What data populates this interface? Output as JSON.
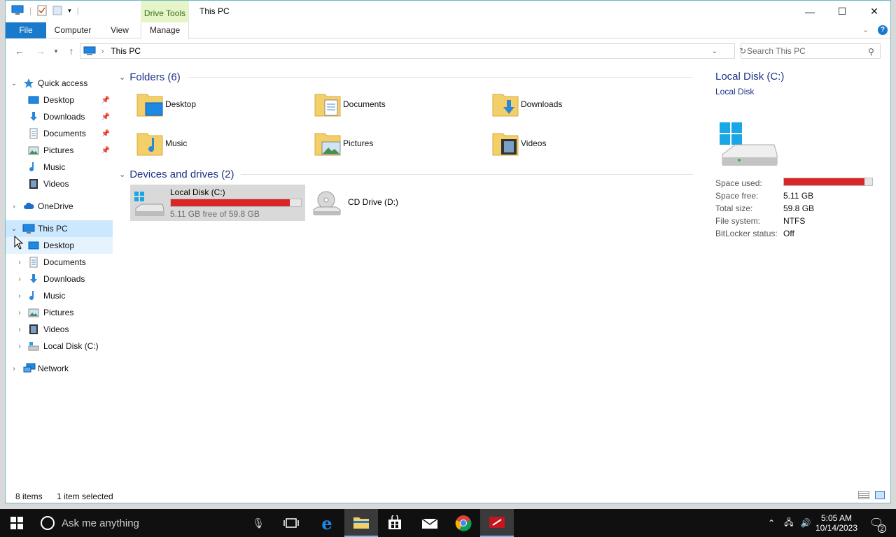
{
  "window": {
    "title": "This PC",
    "context_tab": "Drive Tools",
    "ribbon_tabs": [
      "File",
      "Computer",
      "View",
      "Manage"
    ],
    "minimize": "—",
    "maximize": "☐",
    "close": "✕"
  },
  "address": {
    "path": "This PC",
    "search_placeholder": "Search This PC"
  },
  "nav": {
    "quick_access": "Quick access",
    "quick_items": [
      "Desktop",
      "Downloads",
      "Documents",
      "Pictures",
      "Music",
      "Videos"
    ],
    "onedrive": "OneDrive",
    "this_pc": "This PC",
    "pc_items": [
      "Desktop",
      "Documents",
      "Downloads",
      "Music",
      "Pictures",
      "Videos",
      "Local Disk (C:)"
    ],
    "network": "Network"
  },
  "content": {
    "folders_header": "Folders (6)",
    "folders": [
      "Desktop",
      "Documents",
      "Downloads",
      "Music",
      "Pictures",
      "Videos"
    ],
    "devices_header": "Devices and drives (2)",
    "drive_c": {
      "name": "Local Disk (C:)",
      "free_text": "5.11 GB free of 59.8 GB",
      "used_fraction": 0.915
    },
    "drive_d": {
      "name": "CD Drive (D:)"
    }
  },
  "details": {
    "title": "Local Disk (C:)",
    "subtitle": "Local Disk",
    "props": [
      {
        "label": "Space used:",
        "value": ""
      },
      {
        "label": "Space free:",
        "value": "5.11 GB"
      },
      {
        "label": "Total size:",
        "value": "59.8 GB"
      },
      {
        "label": "File system:",
        "value": "NTFS"
      },
      {
        "label": "BitLocker status:",
        "value": "Off"
      }
    ]
  },
  "status": {
    "items": "8 items",
    "selected": "1 item selected"
  },
  "taskbar": {
    "search_text": "Ask me anything",
    "time": "5:05 AM",
    "date": "10/14/2023",
    "notifications": "2"
  },
  "colors": {
    "accent": "#1979ca",
    "used_bar": "#da2626",
    "selection": "#cce8ff"
  }
}
